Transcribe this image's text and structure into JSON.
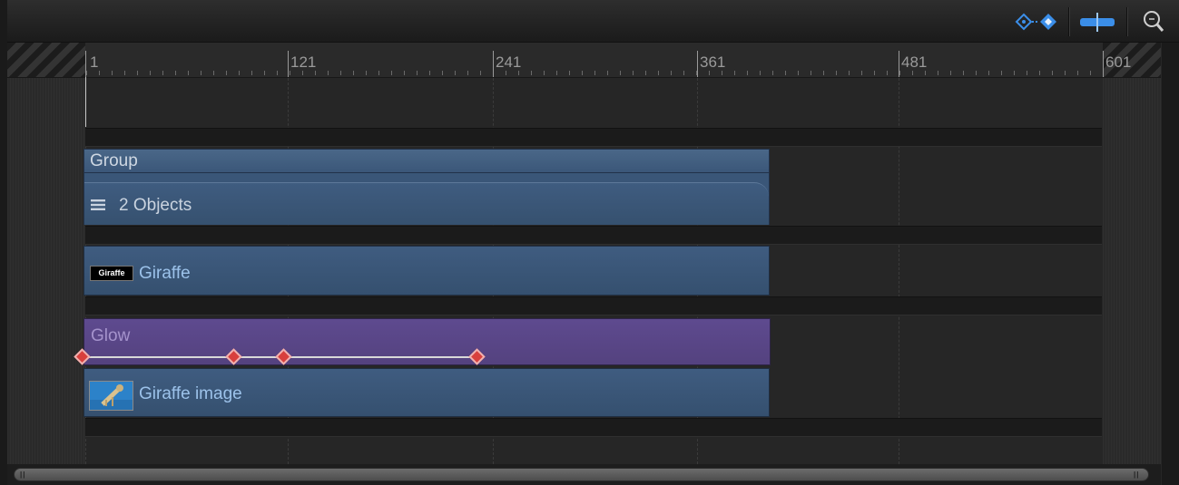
{
  "toolbar": {
    "buttons": [
      {
        "name": "show-keyframes",
        "icon": "keyframe-diamonds-icon",
        "color": "#3b8ee8"
      },
      {
        "name": "show-audio-bar",
        "icon": "audio-bar-icon",
        "color": "#3b8ee8"
      },
      {
        "name": "zoom",
        "icon": "zoom-magnifier-icon",
        "color": "#cfcfcf"
      }
    ]
  },
  "ruler": {
    "labels": [
      "1",
      "121",
      "241",
      "361",
      "481",
      "601"
    ]
  },
  "tracks": {
    "group": {
      "header": "Group",
      "body": "2 Objects",
      "icon": "list-icon"
    },
    "giraffe_text": {
      "label": "Giraffe",
      "thumbnail_text": "Giraffe"
    },
    "glow": {
      "label": "Glow",
      "keyframes_count": 4
    },
    "giraffe_image": {
      "label": "Giraffe image",
      "icon": "image-thumbnail-icon"
    }
  },
  "colors": {
    "clip_blue": "#3f5c80",
    "filter_purple": "#5e4a8f",
    "keyframe": "#d8403d",
    "label_text": "#9cc2ea"
  }
}
